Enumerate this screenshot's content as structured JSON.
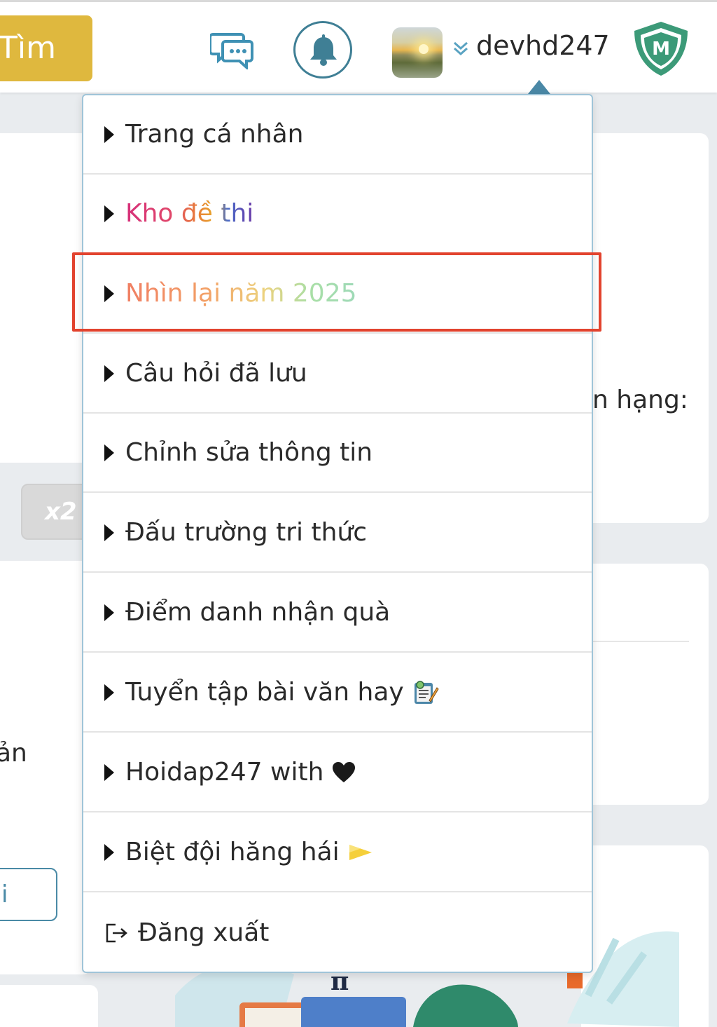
{
  "header": {
    "search_label": "Tìm",
    "username": "devhd247",
    "shield_letter": "M",
    "icons": [
      "chat-icon",
      "bell-icon",
      "avatar",
      "chevron-down-icon",
      "shield-badge-icon"
    ]
  },
  "background": {
    "rank_fragment": "n hạng:",
    "x2_label": "x2",
    "fragment_an": "ản",
    "outline_button_fragment": "i",
    "pi_symbol": "π"
  },
  "user_menu": {
    "items": [
      {
        "label": "Trang cá nhân"
      },
      {
        "label": "Kho đề thi"
      },
      {
        "label": "Nhìn lại năm 2025"
      },
      {
        "label": "Câu hỏi đã lưu"
      },
      {
        "label": "Chỉnh sửa thông tin"
      },
      {
        "label": "Đấu trường tri thức"
      },
      {
        "label": "Điểm danh nhận quà"
      },
      {
        "label": "Tuyển tập bài văn hay",
        "icon": "notepad-pencil-icon"
      },
      {
        "label": "Hoidap247 with",
        "icon": "heart-icon"
      },
      {
        "label": "Biệt đội hăng hái",
        "icon": "flag-icon"
      },
      {
        "label": "Đăng xuất",
        "icon": "logout-icon"
      }
    ],
    "highlighted_item": "Nhìn lại năm 2025"
  },
  "colors": {
    "search_button": "#dfb83e",
    "accent_teal": "#3f7f95",
    "highlight_red": "#e2432e",
    "menu_border": "#9fc4d8"
  }
}
